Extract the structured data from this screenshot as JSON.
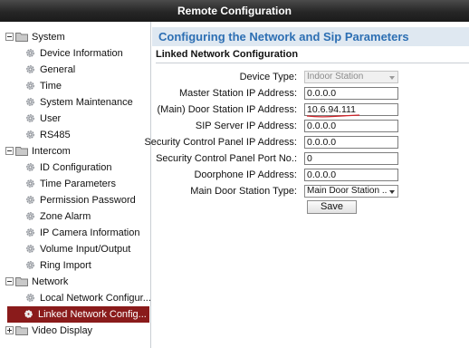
{
  "window": {
    "title": "Remote Configuration"
  },
  "sidebar": {
    "groups": [
      {
        "label": "System",
        "expanded": true,
        "items": [
          "Device Information",
          "General",
          "Time",
          "System Maintenance",
          "User",
          "RS485"
        ]
      },
      {
        "label": "Intercom",
        "expanded": true,
        "items": [
          "ID Configuration",
          "Time Parameters",
          "Permission Password",
          "Zone Alarm",
          "IP Camera Information",
          "Volume Input/Output",
          "Ring Import"
        ]
      },
      {
        "label": "Network",
        "expanded": true,
        "items": [
          "Local Network Configur...",
          "Linked Network Config..."
        ],
        "selected_item": "Linked Network Config..."
      },
      {
        "label": "Video Display",
        "expanded": false,
        "items": []
      }
    ]
  },
  "main": {
    "header": "Configuring the Network and Sip Parameters",
    "section_title": "Linked Network Configuration",
    "fields": {
      "device_type": {
        "label": "Device Type:",
        "value": "Indoor Station",
        "disabled": true
      },
      "master_ip": {
        "label": "Master Station IP Address:",
        "value": "0.0.0.0"
      },
      "main_door_ip": {
        "label": "(Main) Door Station IP Address:",
        "value": "10.6.94.111"
      },
      "sip_ip": {
        "label": "SIP Server IP Address:",
        "value": "0.0.0.0"
      },
      "security_ip": {
        "label": "Security Control Panel IP Address:",
        "value": "0.0.0.0"
      },
      "security_port": {
        "label": "Security Control Panel Port No.:",
        "value": "0"
      },
      "doorphone_ip": {
        "label": "Doorphone IP Address:",
        "value": "0.0.0.0"
      },
      "main_door_type": {
        "label": "Main Door Station Type:",
        "value": "Main Door Station ..."
      }
    },
    "save_label": "Save"
  },
  "colors": {
    "titlebar": "#262626",
    "header_band": "#dfe8f1",
    "header_text": "#2d6fb3",
    "selected_item": "#8a1b1b",
    "annotation_underline": "#d0242b"
  }
}
